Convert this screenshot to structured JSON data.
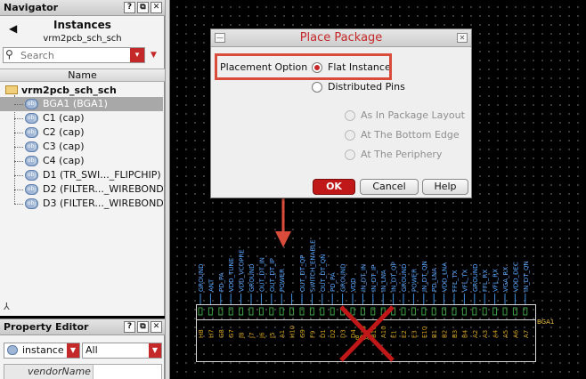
{
  "navigator": {
    "title": "Navigator",
    "header_title": "Instances",
    "header_subtitle": "vrm2pcb_sch_sch",
    "search_placeholder": "Search",
    "column_header": "Name",
    "root": "vrm2pcb_sch_sch",
    "items": [
      {
        "label": "BGA1 (BGA1)",
        "selected": true
      },
      {
        "label": "C1 (cap)",
        "selected": false
      },
      {
        "label": "C2 (cap)",
        "selected": false
      },
      {
        "label": "C3 (cap)",
        "selected": false
      },
      {
        "label": "C4 (cap)",
        "selected": false
      },
      {
        "label": "D1 (TR_SWI..._FLIPCHIP)",
        "selected": false
      },
      {
        "label": "D2 (FILTER..._WIREBOND)",
        "selected": false
      },
      {
        "label": "D3 (FILTER..._WIREBOND)",
        "selected": false
      }
    ],
    "object_badge": "obj"
  },
  "property_editor": {
    "title": "Property Editor",
    "type_value": "instance",
    "filter_value": "All",
    "first_row_key": "vendorName"
  },
  "dialog": {
    "title": "Place Package",
    "placement_option_label": "Placement Option",
    "options": [
      {
        "label": "Flat Instance",
        "selected": true,
        "enabled": true
      },
      {
        "label": "Distributed Pins",
        "selected": false,
        "enabled": true
      }
    ],
    "sub_options": [
      {
        "label": "As In Package Layout",
        "selected": true,
        "enabled": false
      },
      {
        "label": "At The Bottom Edge",
        "selected": false,
        "enabled": false
      },
      {
        "label": "At The Periphery",
        "selected": false,
        "enabled": false
      }
    ],
    "ok_label": "OK",
    "cancel_label": "Cancel",
    "help_label": "Help"
  },
  "schematic": {
    "instance_name": "BGA1",
    "instance_label": "BGA1",
    "pins": [
      {
        "name": "GROUND",
        "num": "H8"
      },
      {
        "name": "ANT",
        "num": "H7"
      },
      {
        "name": "PD_PA",
        "num": "G8"
      },
      {
        "name": "VDD_TUNE",
        "num": "G7"
      },
      {
        "name": "VDD_VCOPRE",
        "num": "J8"
      },
      {
        "name": "GROUND",
        "num": "J7"
      },
      {
        "name": "OUT_DT_IN",
        "num": "J6"
      },
      {
        "name": "OUT_DT_IP",
        "num": "J5"
      },
      {
        "name": "POWER",
        "num": "A1"
      },
      {
        "name": "",
        "num": "H10"
      },
      {
        "name": "OUT_DT_QP",
        "num": "G9"
      },
      {
        "name": "SWITCH_ENABLE",
        "num": "F9"
      },
      {
        "name": "OUT_DT_QN",
        "num": "D1"
      },
      {
        "name": "PD_PA",
        "num": "D2"
      },
      {
        "name": "GROUND",
        "num": "D3"
      },
      {
        "name": "VDD",
        "num": "D4"
      },
      {
        "name": "IN_DT_IN",
        "num": "C10"
      },
      {
        "name": "IN_DT_IP",
        "num": "B10"
      },
      {
        "name": "IN_LNA",
        "num": "A10"
      },
      {
        "name": "IN_DT_QP",
        "num": "E1"
      },
      {
        "name": "GROUND",
        "num": "E2"
      },
      {
        "name": "POWER",
        "num": "E3"
      },
      {
        "name": "IN_DT_QN",
        "num": "E10"
      },
      {
        "name": "PD_LNA",
        "num": "B1"
      },
      {
        "name": "VDD_LNA",
        "num": "B2"
      },
      {
        "name": "FFL_TX",
        "num": "B3"
      },
      {
        "name": "VFL_TX",
        "num": "B4"
      },
      {
        "name": "GROUND",
        "num": "A2"
      },
      {
        "name": "FFL_RX",
        "num": "A3"
      },
      {
        "name": "VFL_RX",
        "num": "A4"
      },
      {
        "name": "VGA_RX",
        "num": "A5"
      },
      {
        "name": "VDD_DEC",
        "num": "A6"
      },
      {
        "name": "IN_DT_QN",
        "num": "A7"
      }
    ]
  },
  "colors": {
    "accent": "#c42828",
    "callout": "#d94c3c",
    "pin": "#3f8ee0",
    "pin_label": "#5aa8ff",
    "pin_number": "#d0a020",
    "x_mark": "#c01818"
  }
}
